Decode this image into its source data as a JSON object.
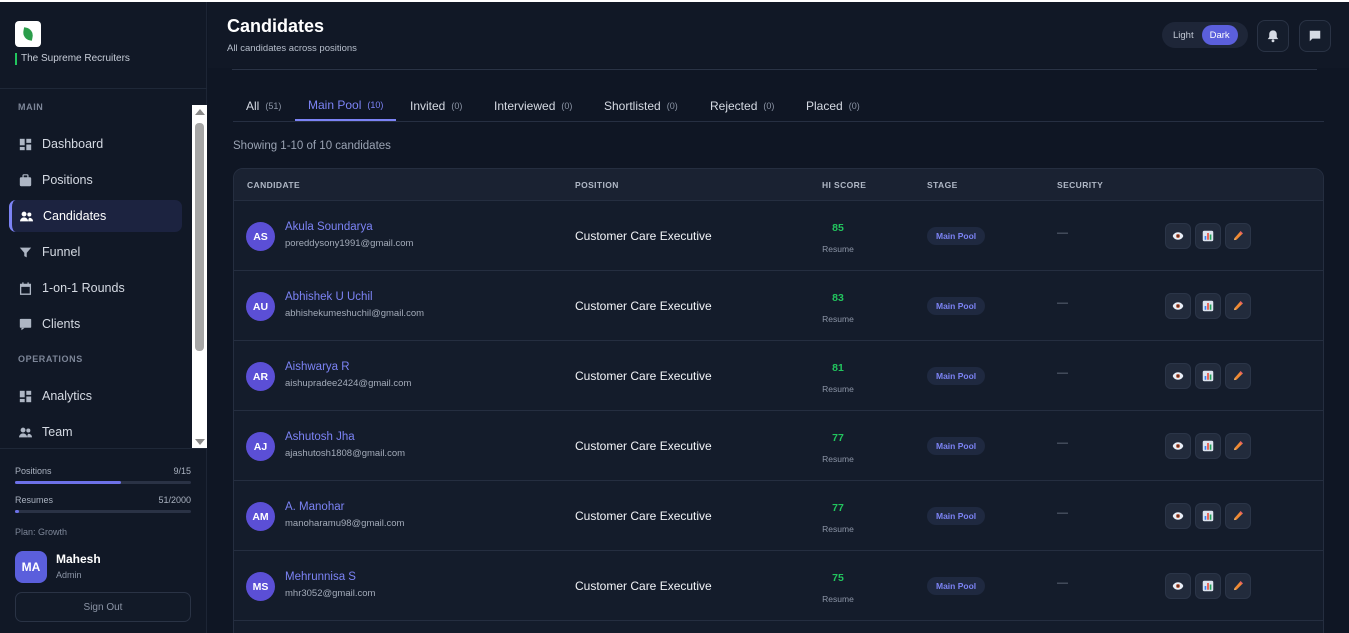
{
  "brand": {
    "name": "The Supreme Recruiters"
  },
  "sidebar": {
    "section_main": "MAIN",
    "section_operations": "OPERATIONS",
    "items": [
      {
        "label": "Dashboard",
        "icon": "dashboard-icon"
      },
      {
        "label": "Positions",
        "icon": "briefcase-icon"
      },
      {
        "label": "Candidates",
        "icon": "people-icon",
        "active": true
      },
      {
        "label": "Funnel",
        "icon": "funnel-icon"
      },
      {
        "label": "1-on-1 Rounds",
        "icon": "calendar-icon"
      },
      {
        "label": "Clients",
        "icon": "clients-icon"
      },
      {
        "label": "Analytics",
        "icon": "analytics-icon"
      },
      {
        "label": "Team",
        "icon": "team-icon"
      }
    ],
    "usage": {
      "positions_label": "Positions",
      "positions_value": "9/15",
      "positions_fraction": 0.6,
      "resumes_label": "Resumes",
      "resumes_value": "51/2000",
      "resumes_fraction": 0.0255
    },
    "plan": "Plan: Growth",
    "user": {
      "initials": "MA",
      "name": "Mahesh",
      "role": "Admin"
    },
    "signout": "Sign Out"
  },
  "header": {
    "title": "Candidates",
    "subtitle": "All candidates across positions",
    "theme_light": "Light",
    "theme_dark": "Dark",
    "theme_selected": "Dark"
  },
  "tabs": [
    {
      "label": "All",
      "count": "(51)"
    },
    {
      "label": "Main Pool",
      "count": "(10)",
      "active": true
    },
    {
      "label": "Invited",
      "count": "(0)"
    },
    {
      "label": "Interviewed",
      "count": "(0)"
    },
    {
      "label": "Shortlisted",
      "count": "(0)"
    },
    {
      "label": "Rejected",
      "count": "(0)"
    },
    {
      "label": "Placed",
      "count": "(0)"
    }
  ],
  "showing": "Showing 1-10 of 10 candidates",
  "table": {
    "columns": [
      "CANDIDATE",
      "POSITION",
      "HI SCORE",
      "STAGE",
      "SECURITY"
    ],
    "rows": [
      {
        "initials": "AS",
        "name": "Akula Soundarya",
        "email": "poreddysony1991@gmail.com",
        "position": "Customer Care Executive",
        "score": "85",
        "score_source": "Resume",
        "stage": "Main Pool",
        "security": "—"
      },
      {
        "initials": "AU",
        "name": "Abhishek U Uchil",
        "email": "abhishekumeshuchil@gmail.com",
        "position": "Customer Care Executive",
        "score": "83",
        "score_source": "Resume",
        "stage": "Main Pool",
        "security": "—"
      },
      {
        "initials": "AR",
        "name": "Aishwarya R",
        "email": "aishupradee2424@gmail.com",
        "position": "Customer Care Executive",
        "score": "81",
        "score_source": "Resume",
        "stage": "Main Pool",
        "security": "—"
      },
      {
        "initials": "AJ",
        "name": "Ashutosh Jha",
        "email": "ajashutosh1808@gmail.com",
        "position": "Customer Care Executive",
        "score": "77",
        "score_source": "Resume",
        "stage": "Main Pool",
        "security": "—"
      },
      {
        "initials": "AM",
        "name": "A. Manohar",
        "email": "manoharamu98@gmail.com",
        "position": "Customer Care Executive",
        "score": "77",
        "score_source": "Resume",
        "stage": "Main Pool",
        "security": "—"
      },
      {
        "initials": "MS",
        "name": "Mehrunnisa S",
        "email": "mhr3052@gmail.com",
        "position": "Customer Care Executive",
        "score": "75",
        "score_source": "Resume",
        "stage": "Main Pool",
        "security": "—"
      }
    ]
  },
  "colors": {
    "accent": "#7c83f5",
    "score_green": "#22c55e",
    "background": "#0f1624",
    "panel": "#141c2b"
  }
}
